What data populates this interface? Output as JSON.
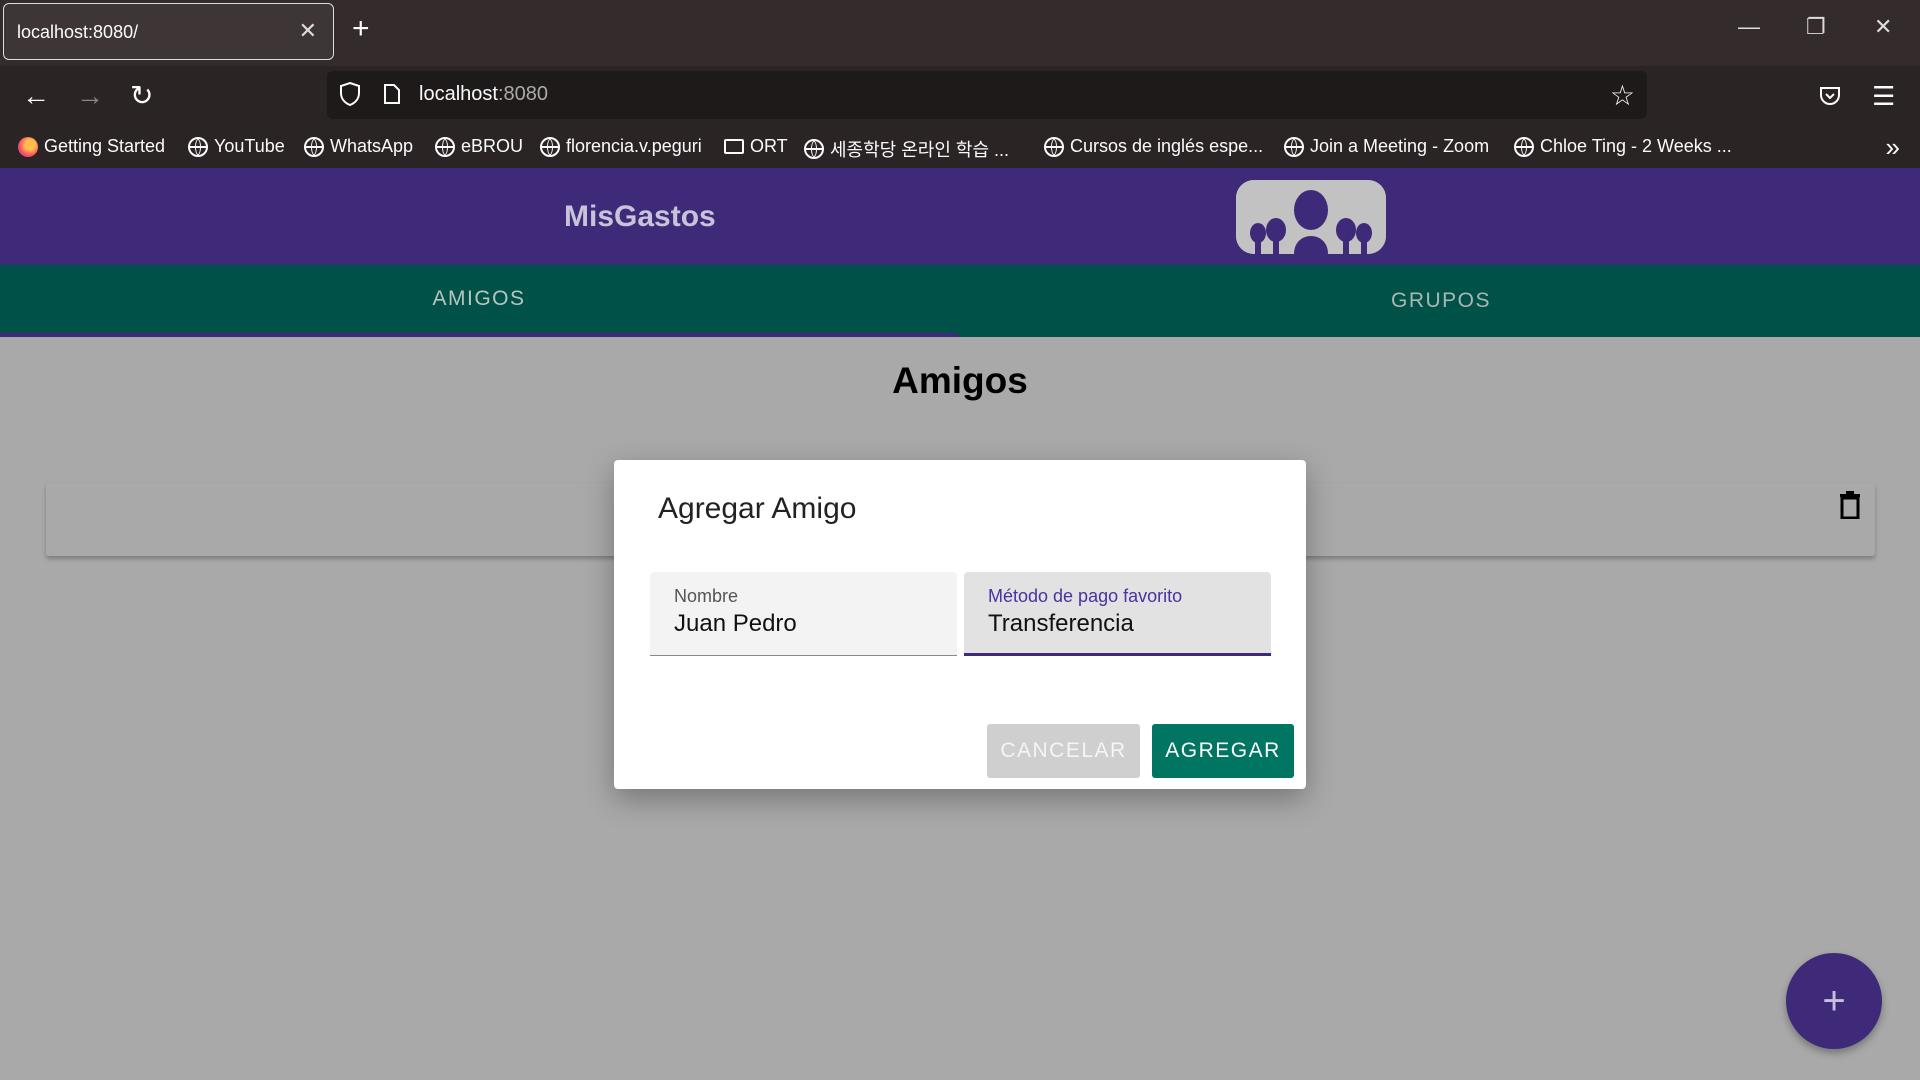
{
  "browser": {
    "tab_title": "localhost:8080/",
    "url_host": "localhost",
    "url_port": ":8080",
    "bookmarks": [
      "Getting Started",
      "YouTube",
      "WhatsApp",
      "eBROU",
      "florencia.v.peguri",
      "ORT",
      "세종학당 온라인 학습 ...",
      "Cursos de inglés espe...",
      "Join a Meeting - Zoom",
      "Chloe Ting - 2 Weeks ..."
    ]
  },
  "app": {
    "title": "MisGastos",
    "tabs": [
      {
        "label": "AMIGOS"
      },
      {
        "label": "GRUPOS"
      }
    ],
    "page_title": "Amigos",
    "fab_label": "+"
  },
  "dialog": {
    "title": "Agregar Amigo",
    "name_label": "Nombre",
    "name_value": "Juan Pedro",
    "payment_label": "Método de pago favorito",
    "payment_value": "Transferencia",
    "cancel_label": "CANCELAR",
    "add_label": "AGREGAR"
  },
  "colors": {
    "header": "#3f2a7a",
    "tabs": "#005248",
    "add_button": "#007561"
  }
}
